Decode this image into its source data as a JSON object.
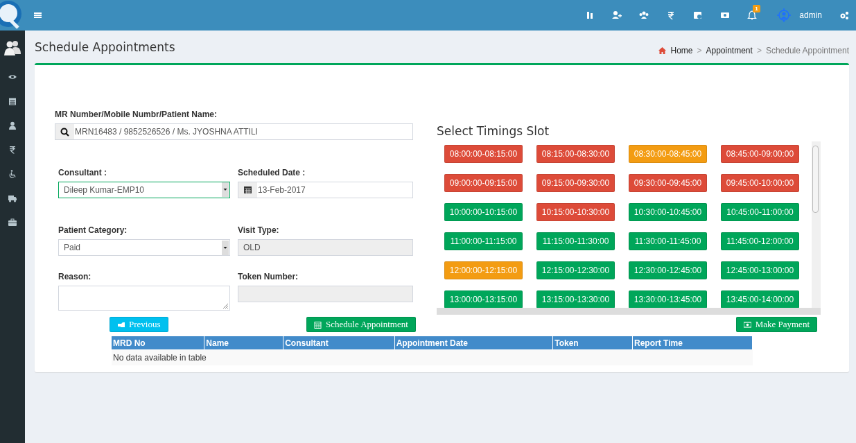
{
  "topbar": {
    "notification_count": "1",
    "user": "admin"
  },
  "page_title": "Schedule Appointments",
  "breadcrumb": [
    {
      "label": "Home",
      "current": false
    },
    {
      "separator_before": ">",
      "label": "Appointment",
      "current": false
    },
    {
      "separator_before": ">",
      "label": "Schedule Appointment",
      "current": true
    }
  ],
  "form": {
    "fields": [
      {
        "kind": "search",
        "label": "MR Number/Mobile Numbr/Patient Name:",
        "value": "MRN16483 / 9852526526 / Ms. JYOSHNA ATTILI",
        "focused": false,
        "disabled": false
      },
      {
        "kind": "select",
        "label": "Consultant :",
        "value": "Dileep Kumar-EMP10",
        "focused": true,
        "disabled": false
      },
      {
        "kind": "date",
        "label": "Scheduled Date :",
        "value": "13-Feb-2017",
        "focused": false,
        "disabled": false
      },
      {
        "kind": "select",
        "label": "Patient Category:",
        "value": "Paid",
        "focused": false,
        "disabled": false
      },
      {
        "kind": "text",
        "label": "Visit Type:",
        "value": "OLD",
        "focused": false,
        "disabled": true
      },
      {
        "kind": "textarea",
        "label": "Reason:",
        "focused": false,
        "disabled": false
      },
      {
        "kind": "text",
        "label": "Token Number:",
        "focused": false,
        "disabled": true
      }
    ]
  },
  "slots": {
    "title": "Select Timings Slot",
    "items": [
      {
        "label": "08:00:00-08:15:00",
        "color": "#dd4b39"
      },
      {
        "label": "08:15:00-08:30:00",
        "color": "#dd4b39"
      },
      {
        "label": "08:30:00-08:45:00",
        "color": "#f39c12"
      },
      {
        "label": "08:45:00-09:00:00",
        "color": "#dd4b39"
      },
      {
        "label": "09:00:00-09:15:00",
        "color": "#dd4b39"
      },
      {
        "label": "09:15:00-09:30:00",
        "color": "#dd4b39"
      },
      {
        "label": "09:30:00-09:45:00",
        "color": "#dd4b39"
      },
      {
        "label": "09:45:00-10:00:00",
        "color": "#dd4b39"
      },
      {
        "label": "10:00:00-10:15:00",
        "color": "#00a65a"
      },
      {
        "label": "10:15:00-10:30:00",
        "color": "#dd4b39"
      },
      {
        "label": "10:30:00-10:45:00",
        "color": "#00a65a"
      },
      {
        "label": "10:45:00-11:00:00",
        "color": "#00a65a"
      },
      {
        "label": "11:00:00-11:15:00",
        "color": "#00a65a"
      },
      {
        "label": "11:15:00-11:30:00",
        "color": "#00a65a"
      },
      {
        "label": "11:30:00-11:45:00",
        "color": "#00a65a"
      },
      {
        "label": "11:45:00-12:00:00",
        "color": "#00a65a"
      },
      {
        "label": "12:00:00-12:15:00",
        "color": "#f39c12"
      },
      {
        "label": "12:15:00-12:30:00",
        "color": "#00a65a"
      },
      {
        "label": "12:30:00-12:45:00",
        "color": "#00a65a"
      },
      {
        "label": "12:45:00-13:00:00",
        "color": "#00a65a"
      },
      {
        "label": "13:00:00-13:15:00",
        "color": "#00a65a"
      },
      {
        "label": "13:15:00-13:30:00",
        "color": "#00a65a"
      },
      {
        "label": "13:30:00-13:45:00",
        "color": "#00a65a"
      },
      {
        "label": "13:45:00-14:00:00",
        "color": "#00a65a"
      }
    ]
  },
  "buttons": [
    {
      "kind": "previous",
      "label": "Previous"
    },
    {
      "kind": "schedule",
      "label": "Schedule Appointment"
    },
    {
      "kind": "payment",
      "label": "Make Payment"
    }
  ],
  "table": {
    "columns": [
      "MRD No",
      "Name",
      "Consultant",
      "Appointment Date",
      "Token",
      "Report Time"
    ],
    "empty_message": "No data available in table"
  }
}
